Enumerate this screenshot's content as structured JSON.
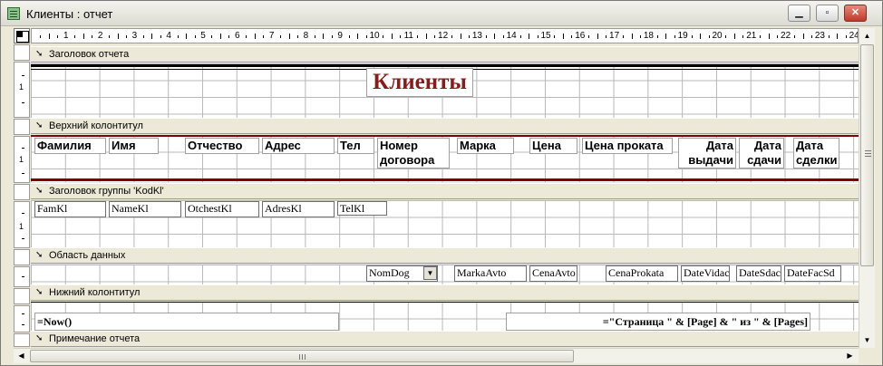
{
  "window": {
    "title": "Клиенты : отчет",
    "minimize": "▁",
    "restore": "▫",
    "close": "✕"
  },
  "ruler": {
    "numbers": [
      "1",
      "2",
      "3",
      "4",
      "5",
      "6",
      "7",
      "8",
      "9",
      "10",
      "11",
      "12",
      "13",
      "14",
      "15",
      "16",
      "17",
      "18",
      "19",
      "20",
      "21",
      "22",
      "23",
      "24"
    ]
  },
  "sections": {
    "report_header": "Заголовок отчета",
    "page_header": "Верхний колонтитул",
    "group_header": "Заголовок группы 'KodKl'",
    "detail": "Область данных",
    "page_footer": "Нижний колонтитул",
    "report_footer": "Примечание отчета"
  },
  "report_title": "Клиенты",
  "column_labels": {
    "familia": "Фамилия",
    "imya": "Имя",
    "otchestvo": "Отчество",
    "adres": "Адрес",
    "tel": "Тел",
    "nomer": "Номер договора",
    "marka": "Марка",
    "cena": "Цена",
    "cena_prokata": "Цена проката",
    "data_vydachi": "Дата выдачи",
    "data_sdachi": "Дата сдачи",
    "data_sdelki": "Дата сделки"
  },
  "group_fields": {
    "fam": "FamKl",
    "name": "NameKl",
    "otch": "OtchestKl",
    "adres": "AdresKl",
    "tel": "TelKl"
  },
  "detail_fields": {
    "nomdog": "NomDog",
    "marka": "MarkaAvto",
    "cena": "CenaAvto",
    "cenaprokata": "CenaProkata",
    "datevidac": "DateVidac",
    "datesdac": "DateSdac",
    "datefacsd": "DateFacSd"
  },
  "footer": {
    "now": "=Now()",
    "page_expr": "=\"Страница \" & [Page] & \" из \" & [Pages]"
  },
  "colors": {
    "title_red": "#8b1a1a",
    "rule_dark_red": "#800000",
    "section_bg": "#ece9d8"
  }
}
